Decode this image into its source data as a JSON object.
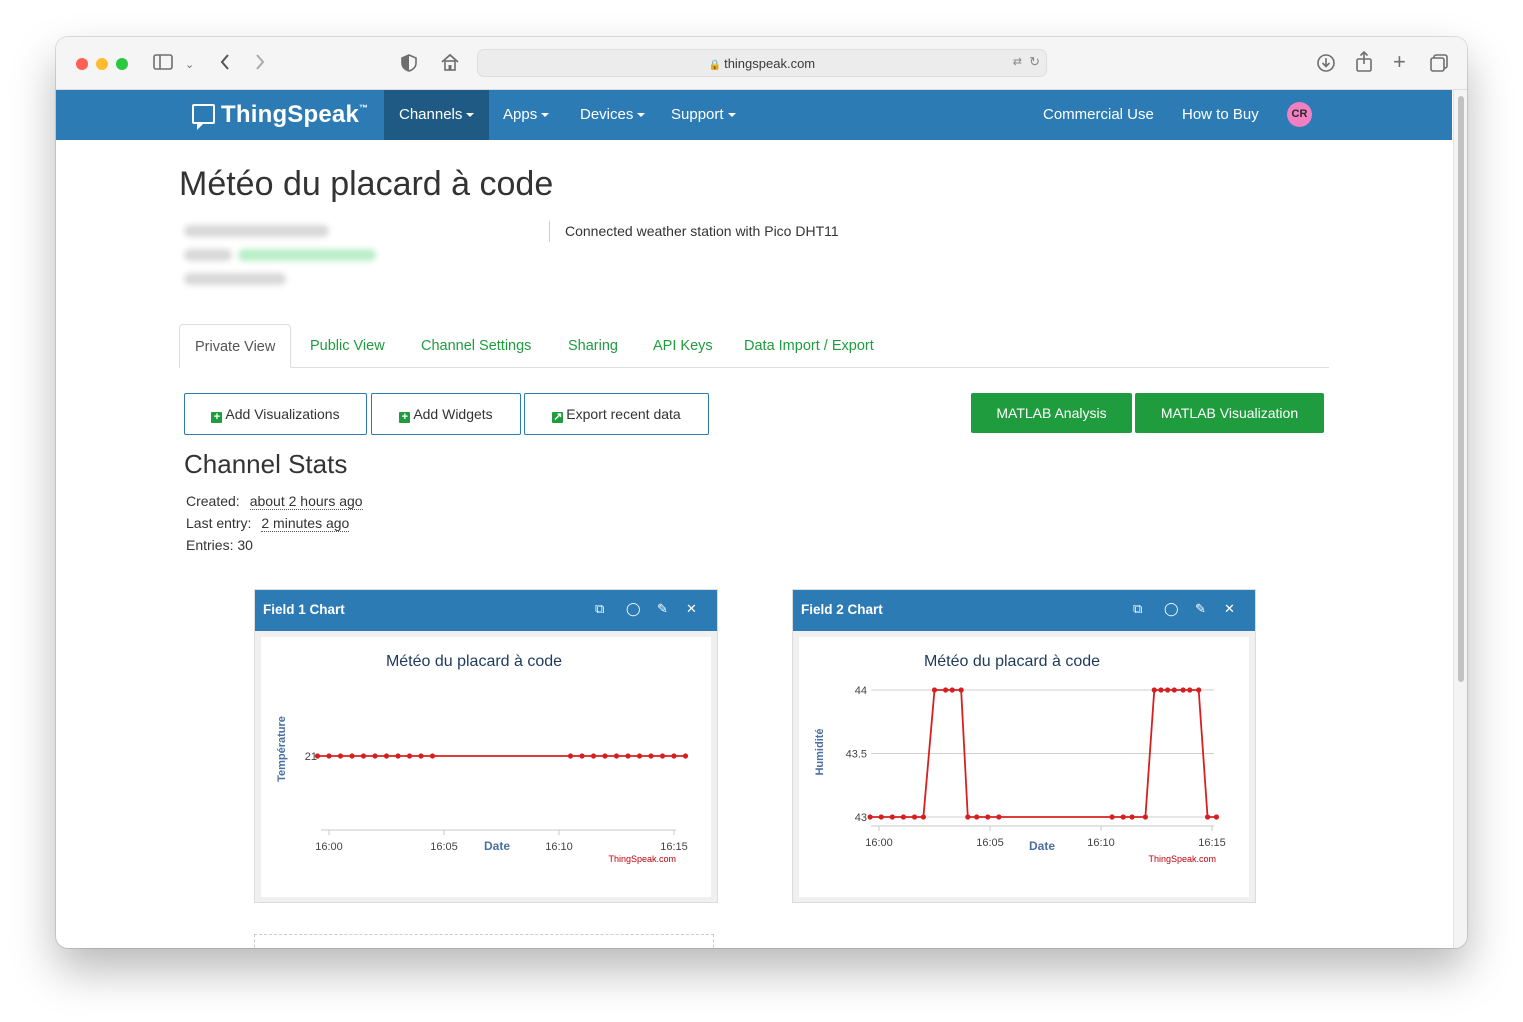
{
  "browser": {
    "url": "thingspeak.com"
  },
  "nav": {
    "brand": "ThingSpeak",
    "brand_tm": "™",
    "items": [
      "Channels",
      "Apps",
      "Devices",
      "Support"
    ],
    "right_items": [
      "Commercial Use",
      "How to Buy"
    ],
    "avatar": "CR"
  },
  "channel": {
    "title": "Météo du placard à code",
    "description": "Connected weather station with Pico DHT11"
  },
  "tabs": [
    "Private View",
    "Public View",
    "Channel Settings",
    "Sharing",
    "API Keys",
    "Data Import / Export"
  ],
  "buttons": {
    "add_visualizations": "Add Visualizations",
    "add_widgets": "Add Widgets",
    "export_recent": "Export recent data",
    "matlab_analysis": "MATLAB Analysis",
    "matlab_visualization": "MATLAB Visualization"
  },
  "stats": {
    "heading": "Channel Stats",
    "created_label": "Created:",
    "created_value": "about 2 hours ago",
    "last_entry_label": "Last entry:",
    "last_entry_value": "2 minutes ago",
    "entries": "Entries: 30"
  },
  "colors": {
    "nav_blue": "#2c7bb5",
    "nav_active": "#1f5a84",
    "green": "#1e9c3e",
    "series_red": "#d62020"
  },
  "panels": [
    {
      "title": "Field 1 Chart",
      "icons": [
        "external-link-icon",
        "comment-icon",
        "pencil-icon",
        "close-icon"
      ]
    },
    {
      "title": "Field 2 Chart",
      "icons": [
        "external-link-icon",
        "comment-icon",
        "pencil-icon",
        "close-icon"
      ]
    }
  ],
  "chart_data": [
    {
      "type": "line",
      "title": "Météo du placard à code",
      "xlabel": "Date",
      "ylabel": "Température",
      "credit": "ThingSpeak.com",
      "x_ticks": [
        "16:00",
        "16:05",
        "16:10",
        "16:15"
      ],
      "xlim": [
        0,
        15
      ],
      "y_ticks": [
        21
      ],
      "ylim": [
        20,
        22
      ],
      "grid": false,
      "series": [
        {
          "x": [
            -0.5,
            0,
            0.5,
            1,
            1.5,
            2,
            2.5,
            3,
            3.5,
            4,
            4.5,
            10.5,
            11,
            11.5,
            12,
            12.5,
            13,
            13.5,
            14,
            14.5,
            15,
            15.5
          ],
          "y": [
            21,
            21,
            21,
            21,
            21,
            21,
            21,
            21,
            21,
            21,
            21,
            21,
            21,
            21,
            21,
            21,
            21,
            21,
            21,
            21,
            21,
            21
          ]
        }
      ]
    },
    {
      "type": "line",
      "title": "Météo du placard à code",
      "xlabel": "Date",
      "ylabel": "Humidité",
      "credit": "ThingSpeak.com",
      "x_ticks": [
        "16:00",
        "16:05",
        "16:10",
        "16:15"
      ],
      "xlim": [
        0,
        15
      ],
      "y_ticks": [
        43,
        43.5,
        44
      ],
      "ylim": [
        43,
        44
      ],
      "grid": true,
      "series": [
        {
          "x": [
            -0.4,
            0.1,
            0.6,
            1.1,
            1.6,
            2.0,
            2.5,
            3.0,
            3.3,
            3.7,
            4.0,
            4.4,
            4.9,
            5.4,
            10.5,
            11.0,
            11.4,
            12.0,
            12.4,
            12.7,
            13.0,
            13.3,
            13.7,
            14.0,
            14.4,
            14.8,
            15.2
          ],
          "y": [
            43,
            43,
            43,
            43,
            43,
            43,
            44,
            44,
            44,
            44,
            43,
            43,
            43,
            43,
            43,
            43,
            43,
            43,
            44,
            44,
            44,
            44,
            44,
            44,
            44,
            43,
            43
          ]
        }
      ]
    }
  ]
}
